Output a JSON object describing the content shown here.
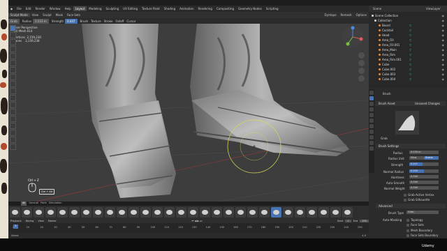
{
  "menu": {
    "items": [
      "File",
      "Edit",
      "Render",
      "Window",
      "Help"
    ],
    "workspaces": [
      "Layout",
      "Modeling",
      "Sculpting",
      "UV Editing",
      "Texture Paint",
      "Shading",
      "Animation",
      "Rendering",
      "Compositing",
      "Geometry Nodes",
      "Scripting"
    ],
    "active_workspace": "Layout",
    "scene": "Scene",
    "view_layer": "ViewLayer"
  },
  "header": {
    "mode": "Sculpt Mode",
    "items": [
      "View",
      "Sculpt",
      "Mask",
      "Face Sets"
    ],
    "right": [
      "Dyntopo",
      "Remesh",
      "Options"
    ]
  },
  "toolbar": {
    "brush": "Grab",
    "radius_label": "Radius",
    "radius_value": "0.033 m",
    "strength_label": "Strength",
    "strength_value": "0.447",
    "menus": [
      "Brush",
      "Texture",
      "Stroke",
      "Falloff",
      "Cursor"
    ]
  },
  "viewport": {
    "info_line1": "User Perspective",
    "info_line2": "(0) Mesh.014",
    "vertices_label": "Vertices",
    "vertices_value": "2,159,230",
    "faces_label": "Faces",
    "faces_value": "2,159,238",
    "key_hint": "Ctrl + Z",
    "key_hint2": "Ctrl + Alt"
  },
  "brush_tabs": [
    "All",
    "General",
    "Paint",
    "Simulation"
  ],
  "timeline": {
    "menus": [
      "Playback",
      "Keying",
      "View",
      "Marker"
    ],
    "current_frame": "1",
    "start_label": "Start",
    "start_value": "1",
    "end_label": "End",
    "end_value": "250",
    "ticks": [
      "0",
      "10",
      "20",
      "30",
      "40",
      "50",
      "60",
      "70",
      "80",
      "90",
      "100",
      "110",
      "120",
      "130",
      "140",
      "150",
      "160",
      "170",
      "180",
      "190",
      "200",
      "210",
      "220",
      "230",
      "240",
      "250"
    ]
  },
  "statusbar": {
    "left": "Select",
    "right": "4.0"
  },
  "outliner": {
    "title": "Scene Collection",
    "collection": "Collection",
    "items": [
      "Beard",
      "Cocktail",
      "Head",
      "Area_Fill",
      "Area_Fill.001",
      "Area_Main",
      "Area_Rim",
      "Area_Rim.001",
      "Cube",
      "Cube.002",
      "Cube.003",
      "Cube.004"
    ]
  },
  "properties": {
    "tool_label": "Brush",
    "brush_asset_label": "Brush Asset",
    "unsaved_label": "Unsaved Changes",
    "brush_name": "Grab",
    "settings_label": "Brush Settings",
    "radius_label": "Radius",
    "radius_value": "0.033 m",
    "radius_unit_label": "Radius Unit",
    "view_label": "View",
    "scene_label": "Scene",
    "strength_label": "Strength",
    "strength_value": "0.447",
    "normal_radius_label": "Normal Radius",
    "normal_radius_value": "0.500",
    "hardness_label": "Hardness",
    "hardness_value": "0.000",
    "autosmooth_label": "Auto-Smooth",
    "autosmooth_value": "0.000",
    "normal_weight_label": "Normal Weight",
    "normal_weight_value": "0.000",
    "grab_active_vertex": "Grab Active Vertex",
    "grab_silhouette": "Grab Silhouette",
    "advanced_label": "Advanced",
    "brush_type_label": "Brush Type",
    "brush_type_value": "Grab",
    "automasking_label": "Auto-Masking",
    "topology": "Topology",
    "face_sets": "Face Sets",
    "mesh_boundary": "Mesh Boundary",
    "face_sets_boundary": "Face Sets Boundary"
  },
  "watermark": "Udemy",
  "colors": {
    "accent": "#4772b3",
    "viewport_bg": "#3d3d3d",
    "cursor": "#d8d85a"
  }
}
